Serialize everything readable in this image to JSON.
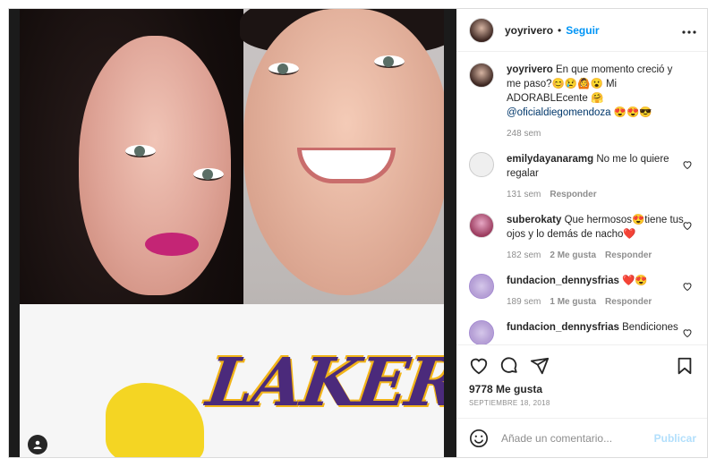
{
  "post": {
    "username": "yoyrivero",
    "separator": "•",
    "follow_label": "Seguir",
    "more_label": "•••"
  },
  "caption": {
    "username": "yoyrivero",
    "text": "En que momento creció y me paso?😊😢🙆😮 Mi ADORABLEcente 🤗",
    "mention": "@oficialdiegomendoza",
    "emojis": "😍😍😎",
    "time": "248 sem"
  },
  "comments": [
    {
      "username": "emilydayanaramg",
      "text": "No me lo quiere regalar",
      "time": "131 sem",
      "likes": "",
      "reply": "Responder"
    },
    {
      "username": "suberokaty",
      "text": "Que hermosos😍tiene tus ojos y lo demás de nacho❤️",
      "time": "182 sem",
      "likes": "2 Me gusta",
      "reply": "Responder"
    },
    {
      "username": "fundacion_dennysfrias",
      "text": "❤️😍",
      "time": "189 sem",
      "likes": "1 Me gusta",
      "reply": "Responder"
    },
    {
      "username": "fundacion_dennysfrias",
      "text": "Bendiciones",
      "time": "",
      "likes": "",
      "reply": ""
    }
  ],
  "photo": {
    "shirt_text": "LAKERS"
  },
  "stats": {
    "likes": "9778 Me gusta",
    "date": "SEPTIEMBRE 18, 2018"
  },
  "composer": {
    "placeholder": "Añade un comentario...",
    "publish_label": "Publicar"
  },
  "colors": {
    "accent": "#0095f6",
    "publish_disabled": "#b2dffc",
    "heart_red": "#ed4956"
  }
}
